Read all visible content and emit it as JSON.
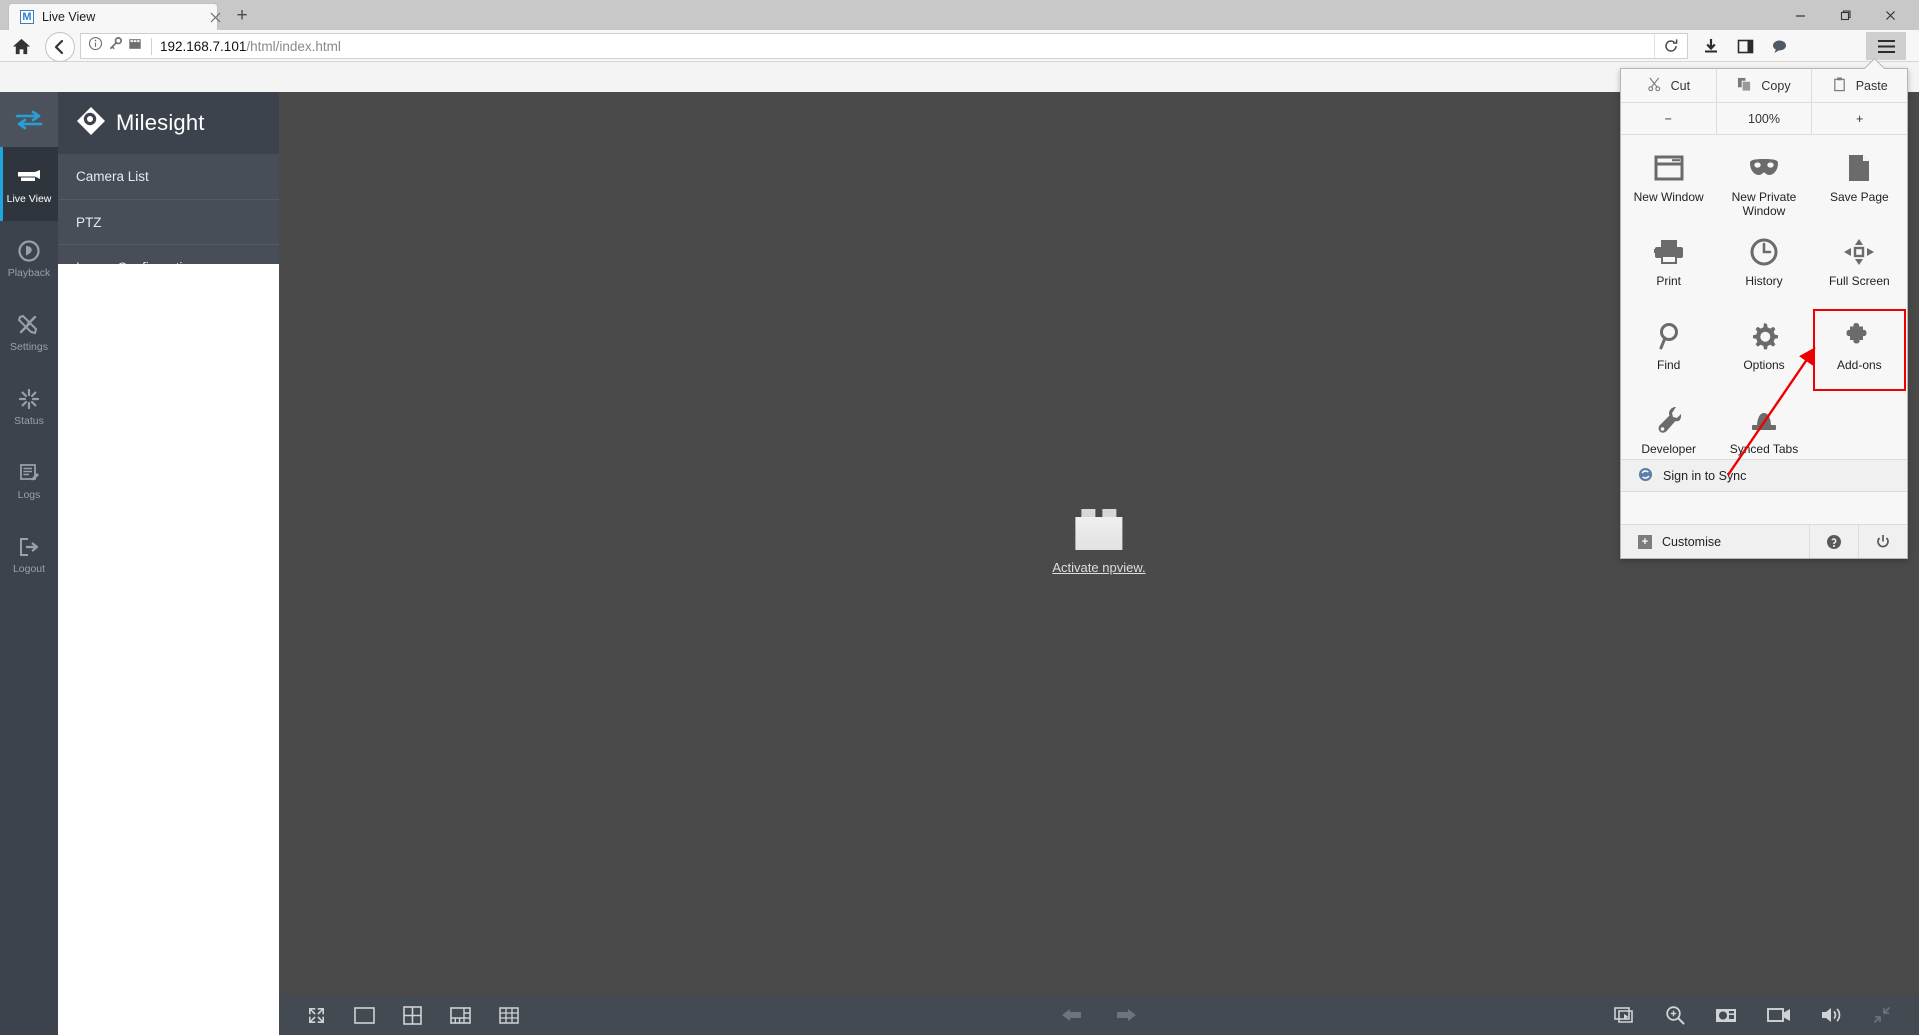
{
  "browser": {
    "tab": {
      "title": "Live View",
      "favicon_letter": "M",
      "close_icon": "close-icon"
    },
    "new_tab_label": "+",
    "window_controls": {
      "minimize": "minimize-icon",
      "maximize": "maximize-icon",
      "close": "close-icon"
    },
    "url": {
      "host": "192.168.7.101",
      "path": "/html/index.html"
    },
    "nav_icons": [
      "home-icon",
      "back-icon",
      "info-icon",
      "key-icon",
      "reader-icon",
      "reload-icon",
      "download-icon",
      "sidebar-icon",
      "chat-icon",
      "hamburger-menu-icon"
    ]
  },
  "menu": {
    "edit_row": [
      {
        "label": "Cut",
        "icon": "scissors-icon"
      },
      {
        "label": "Copy",
        "icon": "copy-icon"
      },
      {
        "label": "Paste",
        "icon": "clipboard-icon"
      }
    ],
    "zoom_row": {
      "minus": "−",
      "level": "100%",
      "plus": "+"
    },
    "items": [
      {
        "label": "New Window",
        "icon": "new-window-icon",
        "highlight": false
      },
      {
        "label": "New Private Window",
        "icon": "mask-icon",
        "highlight": false
      },
      {
        "label": "Save Page",
        "icon": "page-icon",
        "highlight": false
      },
      {
        "label": "Print",
        "icon": "printer-icon",
        "highlight": false
      },
      {
        "label": "History",
        "icon": "clock-icon",
        "highlight": false
      },
      {
        "label": "Full Screen",
        "icon": "fullscreen-icon",
        "highlight": false
      },
      {
        "label": "Find",
        "icon": "magnifier-icon",
        "highlight": false
      },
      {
        "label": "Options",
        "icon": "gear-icon",
        "highlight": false
      },
      {
        "label": "Add-ons",
        "icon": "puzzle-icon",
        "highlight": true
      },
      {
        "label": "Developer",
        "icon": "wrench-icon",
        "highlight": false
      },
      {
        "label": "Synced Tabs",
        "icon": "synced-tabs-icon",
        "highlight": false
      }
    ],
    "sync": {
      "label": "Sign in to Sync",
      "icon": "sync-icon"
    },
    "customise": {
      "label": "Customise",
      "icon": "plus-box-icon"
    },
    "help": "help-icon",
    "power": "power-icon",
    "highlight_color": "#ee0000"
  },
  "app": {
    "brand": "Milesight",
    "rail": [
      {
        "label": "Live View",
        "icon": "live-view-icon",
        "active": true
      },
      {
        "label": "Playback",
        "icon": "playback-icon",
        "active": false
      },
      {
        "label": "Settings",
        "icon": "settings-icon",
        "active": false
      },
      {
        "label": "Status",
        "icon": "status-icon",
        "active": false
      },
      {
        "label": "Logs",
        "icon": "logs-icon",
        "active": false
      },
      {
        "label": "Logout",
        "icon": "logout-icon",
        "active": false
      }
    ],
    "rail_toggle_icon": "collapse-toggle-icon",
    "submenu": [
      "Camera List",
      "PTZ",
      "Image Configuration"
    ],
    "plugin": {
      "link_text": "Activate npview.",
      "icon": "plugin-puzzle-icon"
    },
    "accent_color": "#1fa7dd",
    "sidebar_color": "#3c434c",
    "video_bg": "#4a4a4a",
    "toolbar": {
      "left": [
        "fullscreen-icon",
        "layout-1-icon",
        "layout-4-icon",
        "layout-6-icon",
        "layout-9-icon"
      ],
      "center": [
        "previous-arrow-icon",
        "next-arrow-icon"
      ],
      "right": [
        "stream-icon",
        "digital-zoom-icon",
        "snapshot-icon",
        "record-icon",
        "audio-icon",
        "exit-fullscreen-icon"
      ]
    }
  }
}
